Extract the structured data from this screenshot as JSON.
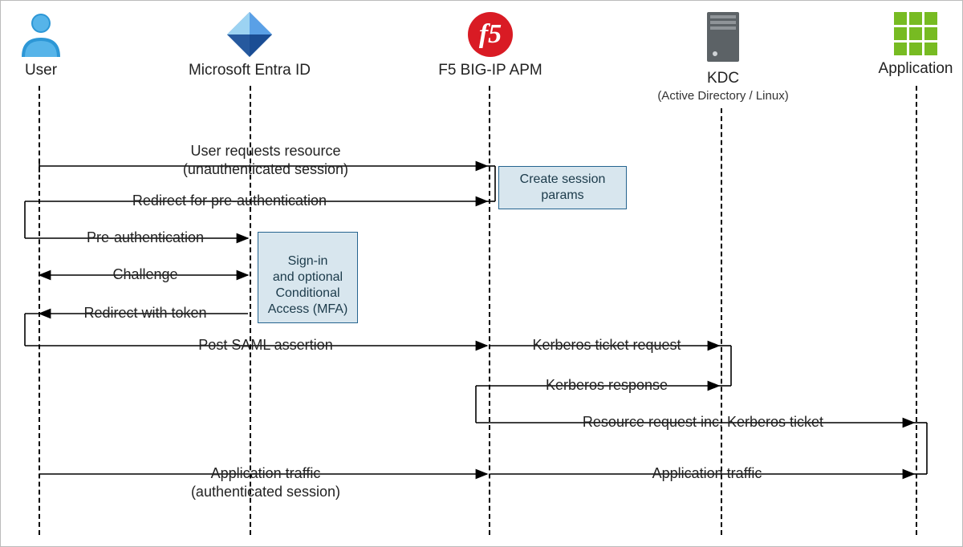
{
  "actors": {
    "user": {
      "label": "User"
    },
    "entra": {
      "label": "Microsoft Entra ID"
    },
    "f5": {
      "label": "F5 BIG-IP APM"
    },
    "kdc": {
      "label": "KDC",
      "sublabel": "(Active Directory / Linux)"
    },
    "application": {
      "label": "Application"
    }
  },
  "boxes": {
    "create_session": "Create session params",
    "signin_box": "Sign-in\nand optional\nConditional\nAccess (MFA)"
  },
  "messages": {
    "m1": "User requests resource\n(unauthenticated session)",
    "m2": "Redirect for pre-authentication",
    "m3": "Pre-authentication",
    "m4": "Challenge",
    "m5": "Redirect with token",
    "m6": "Post SAML assertion",
    "m7": "Kerberos ticket request",
    "m8": "Kerberos response",
    "m9": "Resource request inc. Kerberos ticket",
    "m10a": "Application traffic\n(authenticated session)",
    "m10b": "Application traffic"
  }
}
